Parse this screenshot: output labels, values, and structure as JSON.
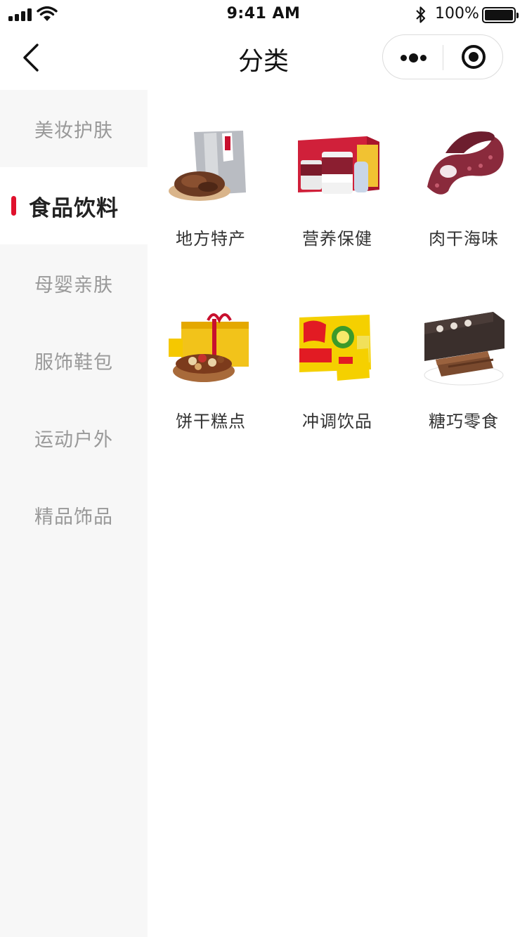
{
  "status_bar": {
    "time": "9:41 AM",
    "battery_percent": "100%"
  },
  "nav": {
    "title": "分类"
  },
  "icons": {
    "back": "chevron-left-icon",
    "more": "more-dots-icon",
    "close": "record-target-icon",
    "bluetooth": "bluetooth-icon",
    "wifi": "wifi-icon",
    "signal": "cellular-signal-icon",
    "battery": "battery-icon"
  },
  "colors": {
    "accent": "#e0112d",
    "sidebar_bg": "#f7f7f7",
    "inactive_text": "#999999"
  },
  "sidebar": {
    "items": [
      {
        "label": "美妆护肤",
        "active": false
      },
      {
        "label": "食品饮料",
        "active": true
      },
      {
        "label": "母婴亲肤",
        "active": false
      },
      {
        "label": "服饰鞋包",
        "active": false
      },
      {
        "label": "运动户外",
        "active": false
      },
      {
        "label": "精品饰品",
        "active": false
      }
    ]
  },
  "categories": [
    {
      "label": "地方特产",
      "image": "dried-meat-bag-image"
    },
    {
      "label": "营养保健",
      "image": "protein-powder-giftbox-image"
    },
    {
      "label": "肉干海味",
      "image": "octopus-tentacle-image"
    },
    {
      "label": "饼干糕点",
      "image": "mixed-nuts-bowl-image"
    },
    {
      "label": "冲调饮品",
      "image": "juice-box-pack-image"
    },
    {
      "label": "糖巧零食",
      "image": "chocolate-roll-cake-image"
    }
  ]
}
